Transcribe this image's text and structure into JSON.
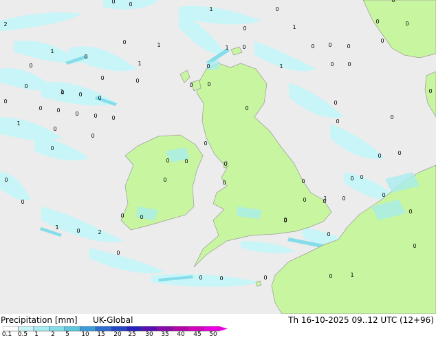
{
  "header": {
    "title": "Precipitation [mm]",
    "model": "UK-Global",
    "valid_time": "Th 16-10-2025 09..12 UTC (12+96)"
  },
  "legend": {
    "tick_labels": [
      "0.1",
      "0.5",
      "1",
      "2",
      "5",
      "10",
      "15",
      "20",
      "25",
      "30",
      "35",
      "40",
      "45",
      "50"
    ],
    "colors": [
      "#ffffff",
      "#c8f5f8",
      "#a6ecf2",
      "#84dde9",
      "#5fc8de",
      "#3c9bd9",
      "#2f6ed0",
      "#2746c6",
      "#2a22b8",
      "#5a10b0",
      "#8a0aa9",
      "#b405a8",
      "#d302bd",
      "#ea00df"
    ]
  },
  "colors": {
    "sea": "#ececec",
    "land": "#c8f5a0",
    "precip_light": "#c8f5f8",
    "precip_medium": "#a6ecf2",
    "precip_heavy": "#5fc8de"
  },
  "map_labels": [
    {
      "text": "0"
    },
    {
      "text": "0"
    },
    {
      "text": "0"
    },
    {
      "text": "0"
    },
    {
      "text": "2"
    },
    {
      "text": "1"
    },
    {
      "text": "0"
    },
    {
      "text": "1"
    },
    {
      "text": "0"
    },
    {
      "text": "0"
    },
    {
      "text": "1"
    },
    {
      "text": "0"
    },
    {
      "text": "1"
    },
    {
      "text": "0"
    },
    {
      "text": "1"
    },
    {
      "text": "0"
    },
    {
      "text": "0"
    },
    {
      "text": "0"
    },
    {
      "text": "0"
    },
    {
      "text": "0"
    },
    {
      "text": "0"
    },
    {
      "text": "1"
    },
    {
      "text": "0"
    },
    {
      "text": "0"
    },
    {
      "text": "1"
    },
    {
      "text": "0"
    },
    {
      "text": "0"
    },
    {
      "text": "0"
    },
    {
      "text": "0"
    },
    {
      "text": "0"
    },
    {
      "text": "0"
    },
    {
      "text": "0"
    },
    {
      "text": "0"
    },
    {
      "text": "0"
    },
    {
      "text": "1"
    },
    {
      "text": "0"
    },
    {
      "text": "0"
    },
    {
      "text": "0"
    },
    {
      "text": "0"
    },
    {
      "text": "0"
    },
    {
      "text": "0"
    },
    {
      "text": "0"
    },
    {
      "text": "0"
    },
    {
      "text": "0"
    },
    {
      "text": "0"
    },
    {
      "text": "0"
    },
    {
      "text": "0"
    },
    {
      "text": "0"
    },
    {
      "text": "0"
    },
    {
      "text": "0"
    },
    {
      "text": "0"
    },
    {
      "text": "0"
    },
    {
      "text": "0"
    },
    {
      "text": "0"
    },
    {
      "text": "0"
    },
    {
      "text": "1"
    },
    {
      "text": "0"
    },
    {
      "text": "0"
    },
    {
      "text": "0"
    },
    {
      "text": "0"
    },
    {
      "text": "0"
    },
    {
      "text": "0"
    },
    {
      "text": "0"
    },
    {
      "text": "0"
    },
    {
      "text": "0"
    },
    {
      "text": "1"
    },
    {
      "text": "0"
    },
    {
      "text": "0"
    },
    {
      "text": "0"
    },
    {
      "text": "0"
    },
    {
      "text": "0"
    },
    {
      "text": "1"
    },
    {
      "text": "2"
    },
    {
      "text": "0"
    },
    {
      "text": "0"
    },
    {
      "text": "0"
    },
    {
      "text": "0"
    },
    {
      "text": "0"
    },
    {
      "text": "1"
    },
    {
      "text": "0"
    },
    {
      "text": "0"
    },
    {
      "text": "0"
    },
    {
      "text": "0"
    },
    {
      "text": "0"
    }
  ]
}
